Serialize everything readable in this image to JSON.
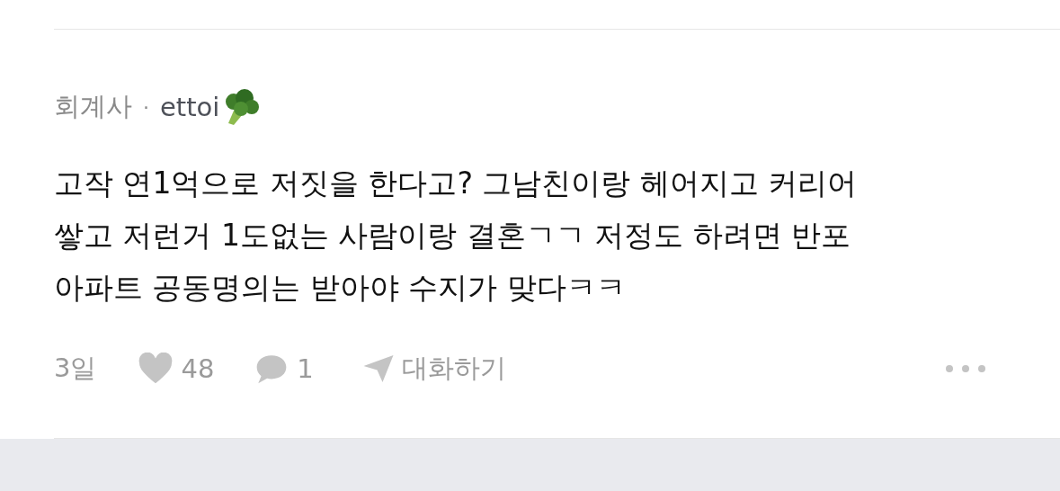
{
  "comment": {
    "author": {
      "job": "회계사",
      "separator": "·",
      "nickname": "ettoi"
    },
    "body_lines": [
      "고작 연1억으로 저짓을 한다고? 그남친이랑 헤어지고 커리어",
      "쌓고 저런거 1도없는 사람이랑 결혼ㄱㄱ 저정도 하려면 반포",
      "아파트 공동명의는 받아야 수지가 맞다ㅋㅋ"
    ],
    "time": "3일",
    "likes": {
      "count": "48",
      "liked": false
    },
    "replies": "1",
    "chat_label": "대화하기"
  }
}
